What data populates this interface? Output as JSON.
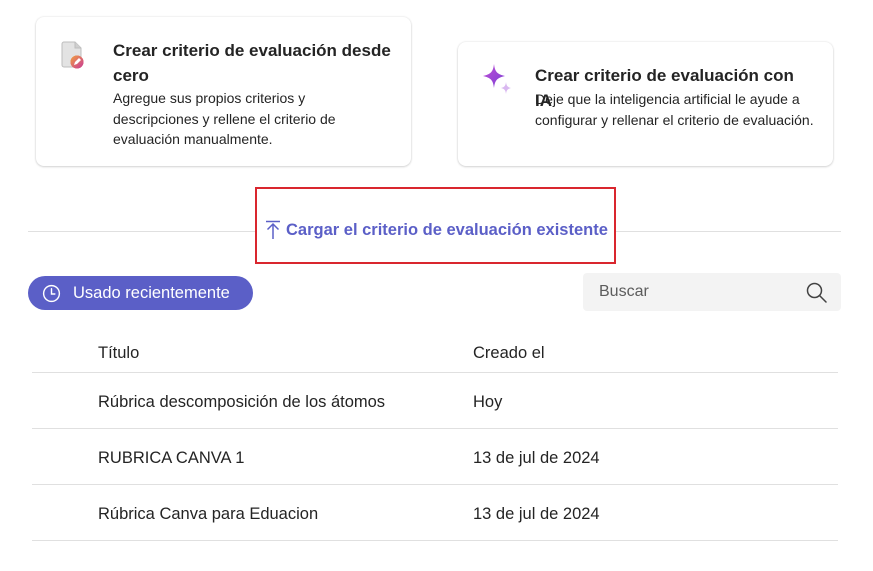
{
  "cards": {
    "scratch": {
      "title": "Crear criterio de evaluación desde cero",
      "description": "Agregue sus propios criterios y descripciones y rellene el criterio de evaluación manualmente.",
      "icon": "document-pencil-icon"
    },
    "ai": {
      "title": "Crear criterio de evaluación con IA",
      "description": "Deje que la inteligencia artificial le ayude a configurar y rellenar el criterio de evaluación.",
      "icon": "sparkle-icon"
    }
  },
  "upload": {
    "label": "Cargar el criterio de evaluación existente",
    "icon": "upload-arrow-icon"
  },
  "filter": {
    "recent_label": "Usado recientemente",
    "icon": "clock-icon"
  },
  "search": {
    "placeholder": "Buscar",
    "value": ""
  },
  "table": {
    "columns": [
      "Título",
      "Creado el"
    ],
    "rows": [
      {
        "title": "Rúbrica descomposición de los átomos",
        "created": "Hoy"
      },
      {
        "title": "RUBRICA CANVA 1",
        "created": "13 de jul de 2024"
      },
      {
        "title": "Rúbrica Canva para Eduacion",
        "created": "13 de jul de 2024"
      }
    ]
  },
  "colors": {
    "accent": "#5b5fc7",
    "highlight_border": "#d9262e",
    "divider": "#e0e0e0",
    "search_bg": "#f3f3f3"
  }
}
